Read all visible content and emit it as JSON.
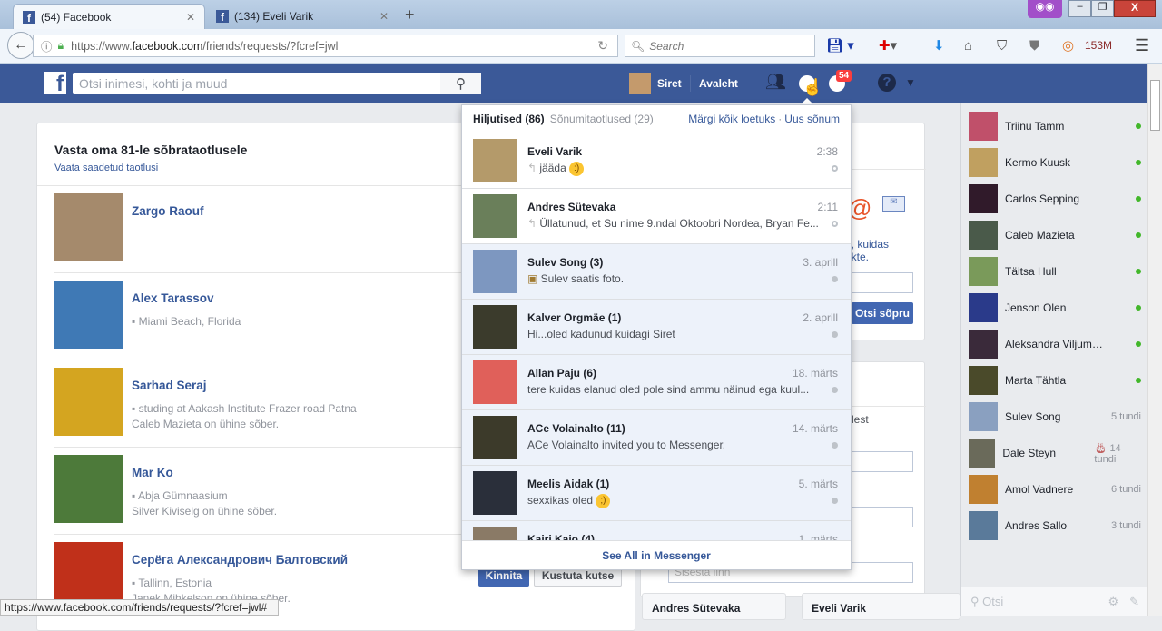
{
  "browser": {
    "tabs": [
      {
        "title": "(54) Facebook",
        "active": true
      },
      {
        "title": "(134) Eveli Varik",
        "active": false
      }
    ],
    "url_prefix": "https://www.",
    "url_domain": "facebook.com",
    "url_path": "/friends/requests/?fcref=jwl",
    "search_placeholder": "Search",
    "memory": "153M",
    "status_url": "https://www.facebook.com/friends/requests/?fcref=jwl#"
  },
  "header": {
    "search_placeholder": "Otsi inimesi, kohti ja muud",
    "user": "Siret",
    "home": "Avaleht",
    "notif_count": "54"
  },
  "requests": {
    "title": "Vasta oma 81-le sõbrataotlusele",
    "sent_link": "Vaata saadetud taotlusi",
    "items": [
      {
        "name": "Zargo Raouf",
        "line1": "",
        "line2": "",
        "color": "#a58a6c"
      },
      {
        "name": "Alex Tarassov",
        "line1": "Miami Beach, Florida",
        "line2": "",
        "color": "#3f79b5"
      },
      {
        "name": "Sarhad Seraj",
        "line1": "studing at Aakash Institute Frazer road Patna",
        "line2": "Caleb Mazieta on ühine sõber.",
        "color": "#d4a520"
      },
      {
        "name": "Mar Ko",
        "line1": "Abja Gümnaasium",
        "line2": "Silver Kiviselg on ühine sõber.",
        "color": "#4d7a3a"
      },
      {
        "name": "Серёга Александрович Балтовский",
        "line1": "Tallinn, Estonia",
        "line2": "Janek Mihkelson on ühine sõber.",
        "color": "#c0301a"
      }
    ],
    "confirm": "Kinnita",
    "delete": "Kustuta kutse"
  },
  "messages": {
    "tab_recent": "Hiljutised (86)",
    "tab_requests": "Sõnumitaotlused",
    "tab_requests_count": "(29)",
    "mark_read": "Märgi kõik loetuks",
    "new_msg": "Uus sõnum",
    "see_all": "See All in Messenger",
    "items": [
      {
        "name": "Eveli Varik",
        "text": "jääda",
        "time": "2:38",
        "unread": false,
        "replied": true,
        "emoji": "smile",
        "color": "#b49a6a"
      },
      {
        "name": "Andres Sütevaka",
        "text": "Üllatunud, et Su nime 9.ndal Oktoobri Nordea, Bryan Fe...",
        "time": "2:11",
        "unread": false,
        "replied": true,
        "color": "#6a7f5a"
      },
      {
        "name": "Sulev Song (3)",
        "text": "Sulev saatis foto.",
        "time": "3. aprill",
        "unread": true,
        "photo": true,
        "color": "#7d97c0"
      },
      {
        "name": "Kalver Orgmäe (1)",
        "text": "Hi...oled kadunud kuidagi Siret",
        "time": "2. aprill",
        "unread": true,
        "color": "#3b3b2c"
      },
      {
        "name": "Allan Paju (6)",
        "text": "tere kuidas elanud oled pole sind ammu näinud ega kuul...",
        "time": "18. märts",
        "unread": true,
        "color": "#e0605a"
      },
      {
        "name": "ACe Volainalto (11)",
        "text": "ACe Volainalto invited you to Messenger.",
        "time": "14. märts",
        "unread": true,
        "color": "#3c3a2a"
      },
      {
        "name": "Meelis Aidak (1)",
        "text": "sexxikas oled",
        "time": "5. märts",
        "unread": true,
        "emoji": "wink",
        "color": "#2a2f3a"
      },
      {
        "name": "Kairi Kaio (4)",
        "text": "",
        "time": "1. märts",
        "unread": true,
        "color": "#8a7a66"
      }
    ]
  },
  "right_panel": {
    "text1": "a, kuidas",
    "text2": "akte.",
    "find_button": "Otsi sõpru",
    "text3": "lest",
    "city_placeholder": "Sisesta linn"
  },
  "chat": {
    "search_placeholder": "Otsi",
    "contacts": [
      {
        "name": "Triinu Tamm",
        "online": true,
        "color": "#c0506a"
      },
      {
        "name": "Kermo Kuusk",
        "online": true,
        "color": "#c0a060"
      },
      {
        "name": "Carlos Sepping",
        "online": true,
        "color": "#301a2a"
      },
      {
        "name": "Caleb Mazieta",
        "online": true,
        "color": "#4a5a4a"
      },
      {
        "name": "Täitsa Hull",
        "online": true,
        "color": "#7a9a5a"
      },
      {
        "name": "Jenson Olen",
        "online": true,
        "color": "#2a3a8a"
      },
      {
        "name": "Aleksandra Viljumovs...",
        "online": true,
        "color": "#3a2a3a"
      },
      {
        "name": "Marta Tähtla",
        "online": true,
        "color": "#4a4a2a"
      },
      {
        "name": "Sulev Song",
        "status": "5 tundi",
        "color": "#8aa0c0"
      },
      {
        "name": "Dale Steyn",
        "status": "14 tundi",
        "birthday": true,
        "color": "#6a6a5a"
      },
      {
        "name": "Amol Vadnere",
        "status": "6 tundi",
        "color": "#c08030"
      },
      {
        "name": "Andres Sallo",
        "status": "3 tundi",
        "color": "#5a7a9a"
      }
    ],
    "open_tabs": [
      "Andres Sütevaka",
      "Eveli Varik"
    ]
  }
}
